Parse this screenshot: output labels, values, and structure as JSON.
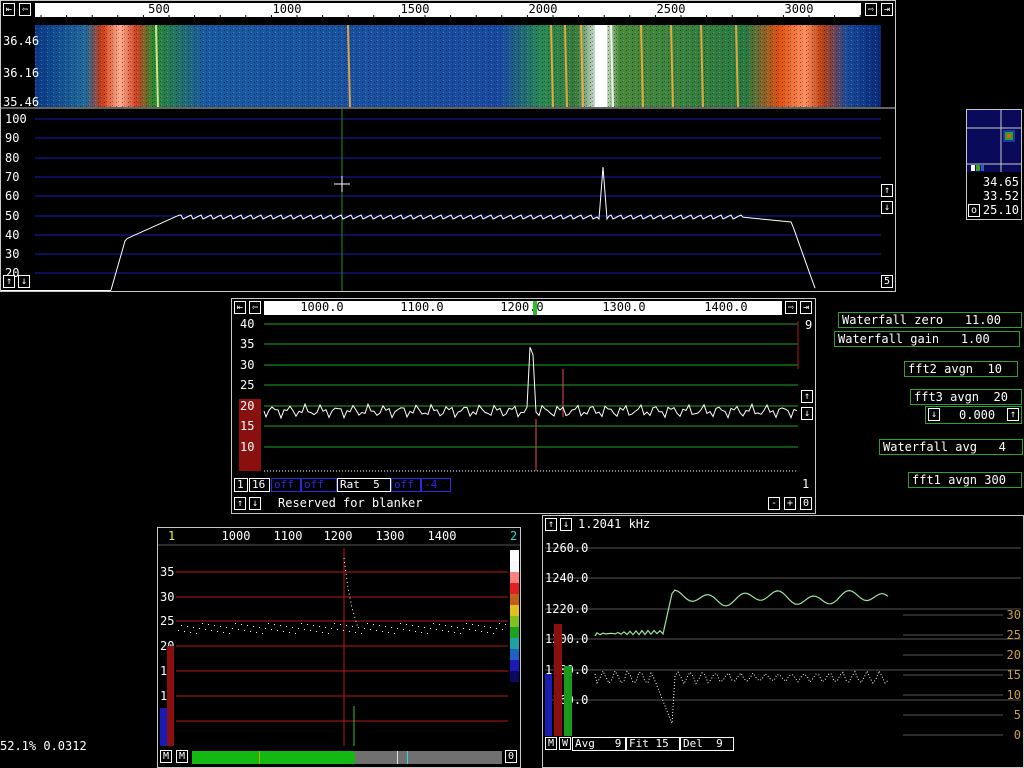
{
  "main": {
    "freq_ticks": [
      "500",
      "1000",
      "1500",
      "2000",
      "2500",
      "3000"
    ],
    "wf_times": [
      "36.46",
      "36.16",
      "35.46"
    ],
    "db_ticks": [
      "100",
      "90",
      "80",
      "70",
      "60",
      "50",
      "40",
      "30",
      "20"
    ],
    "mode_num": "5"
  },
  "baseband": {
    "freq_ticks": [
      "1000.0",
      "1100.0",
      "1200.0",
      "1300.0",
      "1400.0"
    ],
    "db_ticks": [
      "40",
      "35",
      "30",
      "25",
      "20",
      "15",
      "10"
    ],
    "right_num_top": "9",
    "right_num_bot": "1",
    "controls": [
      "1",
      "16",
      "off",
      "off",
      "Rat  5",
      "off",
      "-4"
    ],
    "status": "Reserved for blanker",
    "minus": "-",
    "plus": "+",
    "zero": "0"
  },
  "settings": [
    {
      "label": "Waterfall zero   11.00"
    },
    {
      "label": "Waterfall gain   1.00"
    },
    {
      "label": "fft2 avgn  10"
    },
    {
      "label": "fft3 avgn  20"
    },
    {
      "label": "Waterfall avg   4"
    },
    {
      "label": "fft1 avgn 300"
    }
  ],
  "fft3_value": "0.000",
  "meter": {
    "values": [
      "34.65",
      "33.52",
      "25.10"
    ],
    "btn": "o"
  },
  "hires": {
    "left_num": "1",
    "right_num": "2",
    "freq_ticks": [
      "1000",
      "1100",
      "1200",
      "1300",
      "1400"
    ],
    "db_ticks": [
      "35",
      "30",
      "25",
      "20",
      "15",
      "10",
      "5"
    ],
    "m1": "M",
    "m2": "M",
    "zero": "0"
  },
  "afc": {
    "freq": "1.2041 kHz",
    "left_ticks": [
      "1260.0",
      "1240.0",
      "1220.0",
      "1200.0",
      "1180.0",
      "1160.0"
    ],
    "right_ticks": [
      "30",
      "25",
      "20",
      "15",
      "10",
      "5",
      "0"
    ],
    "m": "M",
    "w": "W",
    "avg": "Avg   9",
    "fit": "Fit 15",
    "del": "Del  9"
  },
  "status": {
    "cpu": "52.1% 0.0312"
  },
  "colors": {
    "green": "#2ea02e",
    "blue": "#1a1ab4",
    "red": "#b41a1a",
    "grid_green": "#1fa31f"
  }
}
